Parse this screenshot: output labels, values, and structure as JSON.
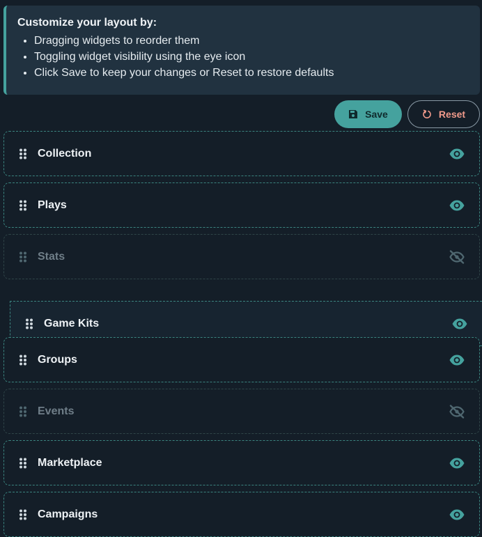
{
  "info": {
    "title": "Customize your layout by:",
    "items": [
      "Dragging widgets to reorder them",
      "Toggling widget visibility using the eye icon",
      "Click Save to keep your changes or Reset to restore defaults"
    ]
  },
  "actions": {
    "save_label": "Save",
    "save_icon": "floppy-disk-icon",
    "reset_label": "Reset",
    "reset_icon": "refresh-icon"
  },
  "widgets": [
    {
      "label": "Collection",
      "visible": true
    },
    {
      "label": "Plays",
      "visible": true
    },
    {
      "label": "Stats",
      "visible": false
    },
    {
      "label": "Game Kits",
      "visible": true,
      "dragging": true
    },
    {
      "label": "Groups",
      "visible": true
    },
    {
      "label": "Events",
      "visible": false
    },
    {
      "label": "Marketplace",
      "visible": true
    },
    {
      "label": "Campaigns",
      "visible": true
    }
  ],
  "colors": {
    "background": "#141e28",
    "accent": "#45a29e",
    "reset": "#f19a8b",
    "muted": "#4f6770"
  }
}
